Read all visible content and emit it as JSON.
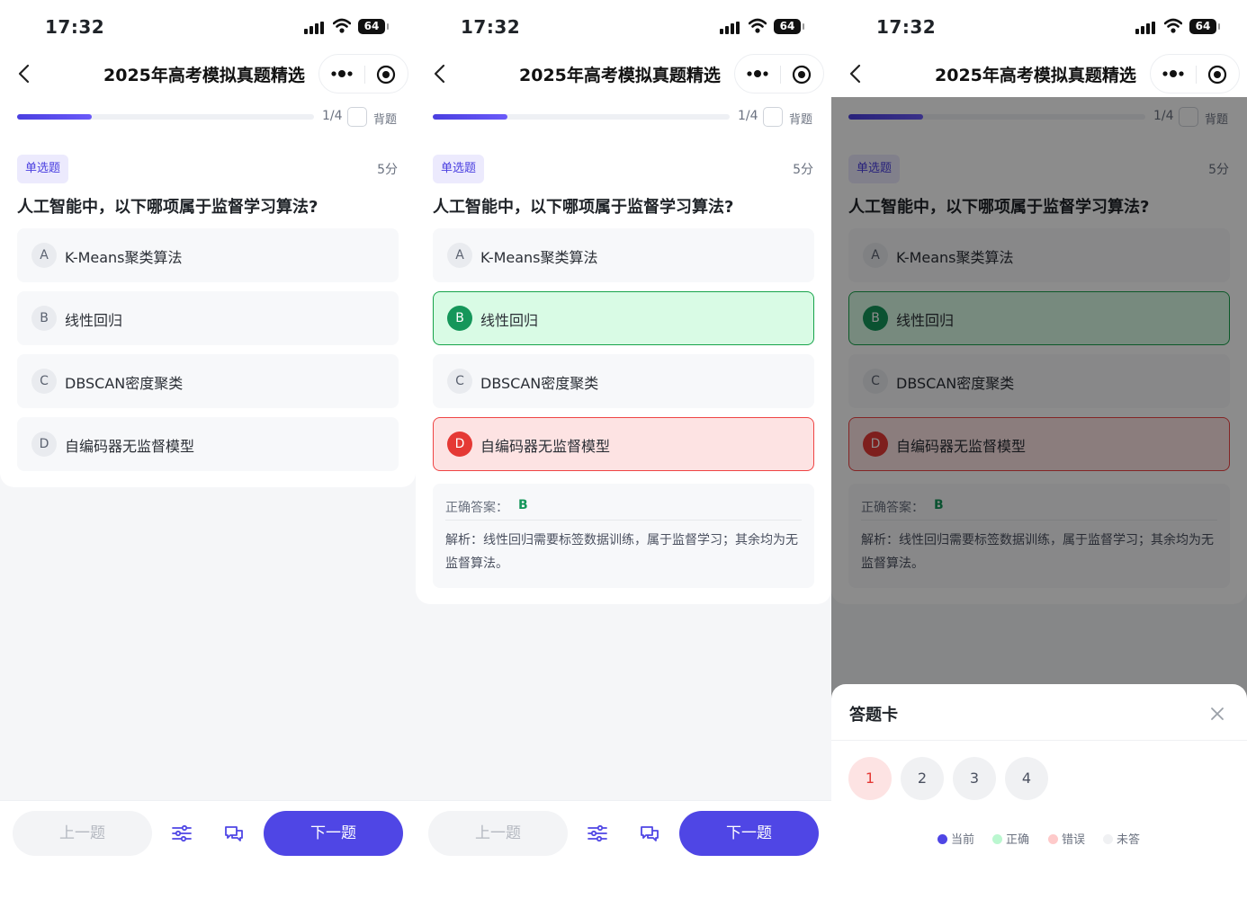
{
  "status": {
    "time": "17:32",
    "battery": "64"
  },
  "nav": {
    "title": "2025年高考模拟真题精选"
  },
  "progress": {
    "count": "1/4",
    "memorize_label": "背题",
    "fraction": 0.25
  },
  "question": {
    "type_tag": "单选题",
    "score": "5分",
    "text": "人工智能中，以下哪项属于监督学习算法?",
    "options": [
      {
        "letter": "A",
        "text": "K-Means聚类算法"
      },
      {
        "letter": "B",
        "text": "线性回归"
      },
      {
        "letter": "C",
        "text": "DBSCAN密度聚类"
      },
      {
        "letter": "D",
        "text": "自编码器无监督模型"
      }
    ]
  },
  "answer": {
    "label": "正确答案：",
    "value": "B",
    "explanation": "解析：线性回归需要标签数据训练，属于监督学习；其余均为无监督算法。"
  },
  "footer": {
    "prev_label": "上一题",
    "next_label": "下一题"
  },
  "answer_sheet": {
    "title": "答题卡",
    "numbers": [
      "1",
      "2",
      "3",
      "4"
    ],
    "legend": [
      {
        "label": "当前",
        "color": "#4f46e5"
      },
      {
        "label": "正确",
        "color": "#bbf7d0"
      },
      {
        "label": "错误",
        "color": "#fecaca"
      },
      {
        "label": "未答",
        "color": "#f0f1f3"
      }
    ]
  },
  "colors": {
    "accent": "#4f46e5",
    "correct": "#15965a",
    "wrong": "#e53935"
  }
}
